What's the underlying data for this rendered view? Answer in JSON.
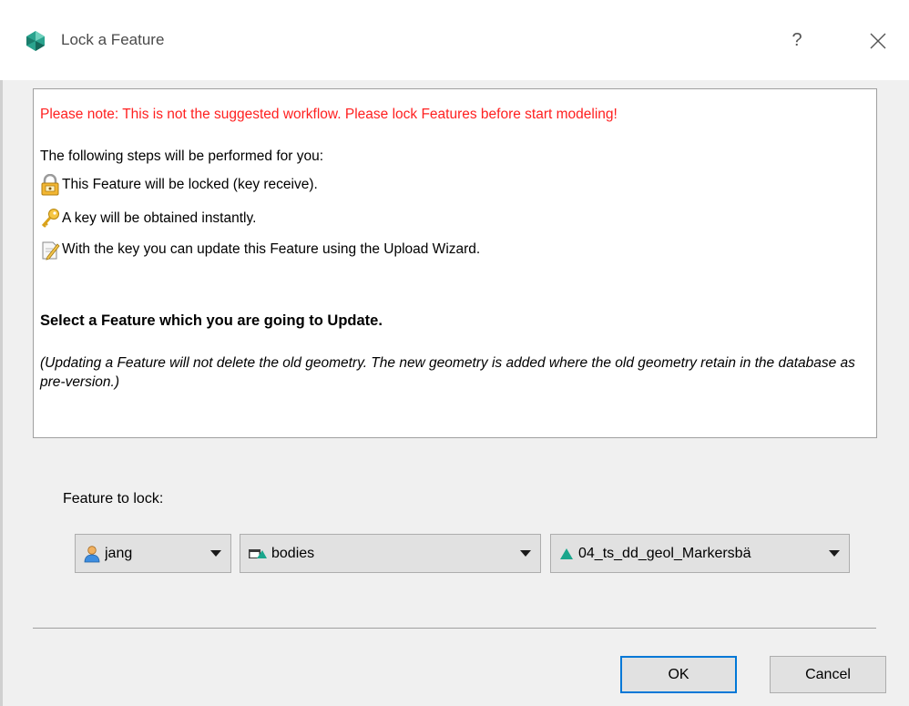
{
  "window": {
    "title": "Lock a Feature",
    "help_label": "?",
    "icon": "app-logo-icon",
    "close_icon": "close-icon"
  },
  "info": {
    "note": "Please note: This is not the suggested workflow. Please lock Features before start modeling!",
    "steps_intro": "The following steps will be performed for you:",
    "steps": [
      {
        "icon": "padlock-icon",
        "text": "This Feature will be locked (key receive)."
      },
      {
        "icon": "key-icon",
        "text": "A key will be obtained instantly."
      },
      {
        "icon": "edit-document-icon",
        "text": "With the key you can update this Feature using the Upload Wizard."
      }
    ],
    "select_heading": "Select a Feature which you are going to Update.",
    "hint": "(Updating a Feature will not delete the old geometry. The new geometry is added where the old geometry retain in the database as pre-version.)"
  },
  "form": {
    "feature_label": "Feature to lock:",
    "owner": {
      "value": "jang",
      "icon": "user-icon"
    },
    "group": {
      "value": "bodies",
      "icon": "folder-surface-icon"
    },
    "feature": {
      "value": "04_ts_dd_geol_Markersbä",
      "icon": "green-triangle-icon"
    }
  },
  "buttons": {
    "ok": "OK",
    "cancel": "Cancel"
  },
  "colors": {
    "note_red": "#ff2020",
    "focus_blue": "#0078d7",
    "triangle_green": "#1aa68c"
  }
}
